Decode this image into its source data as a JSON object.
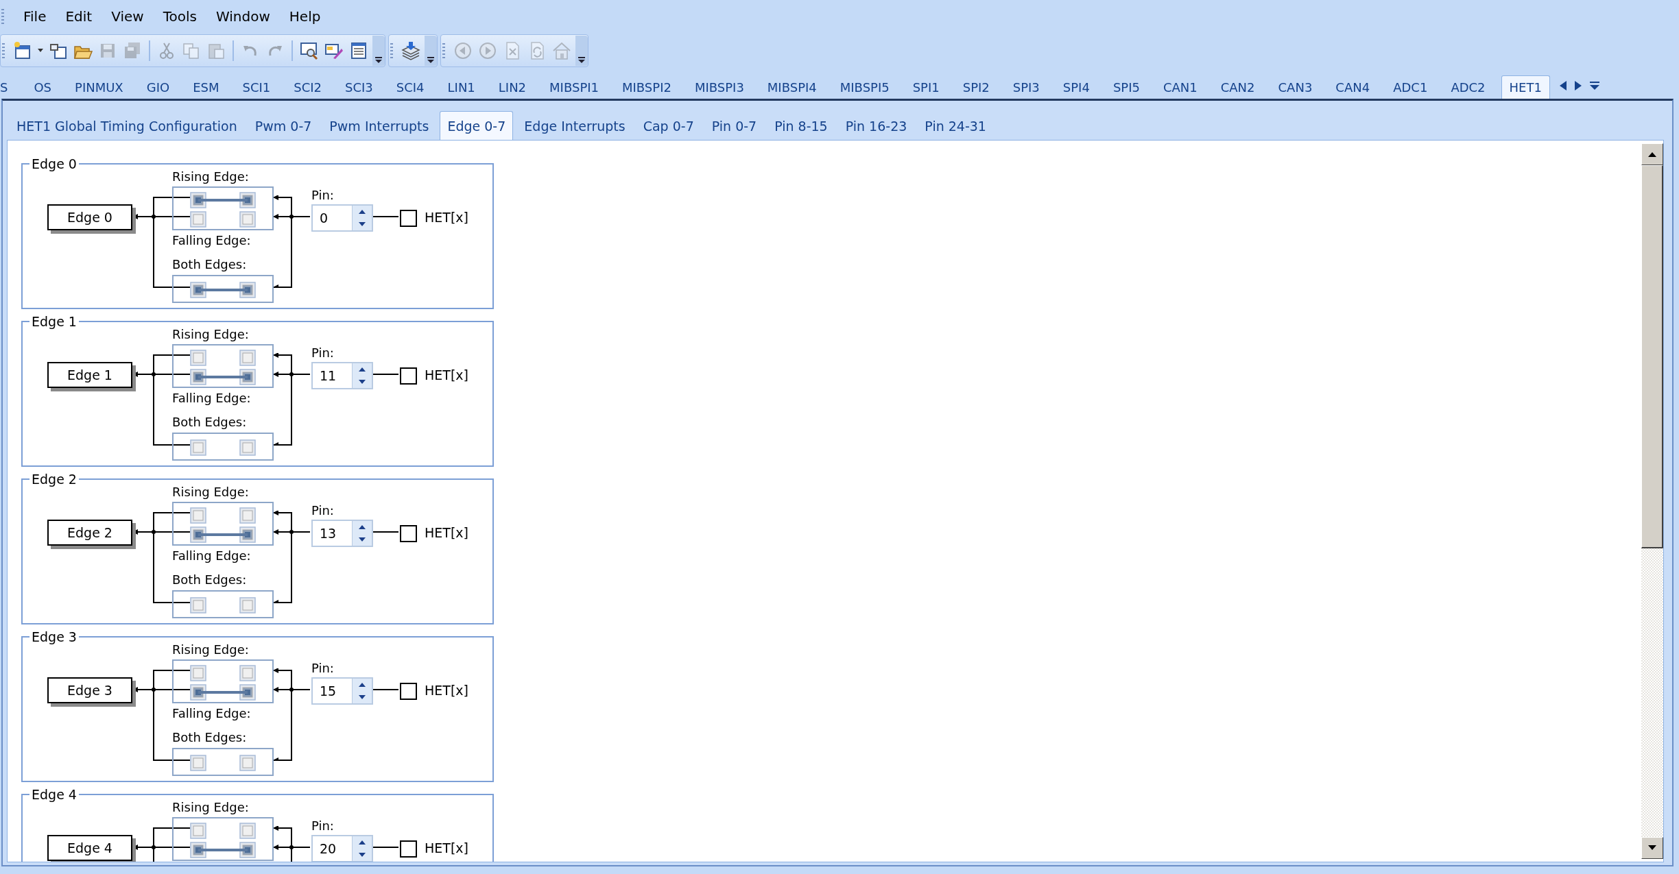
{
  "menu": [
    {
      "label": "File"
    },
    {
      "label": "Edit"
    },
    {
      "label": "View"
    },
    {
      "label": "Tools"
    },
    {
      "label": "Window"
    },
    {
      "label": "Help"
    }
  ],
  "toolbar": [
    {
      "items": [
        {
          "disabled": false
        },
        {
          "disabled": false
        },
        {
          "disabled": false
        },
        {
          "disabled": false
        },
        {
          "disabled": true
        },
        {
          "disabled": true
        },
        {
          "disabled": true
        },
        {
          "disabled": true
        },
        {
          "disabled": true
        },
        {
          "disabled": true
        },
        {
          "disabled": true
        },
        {
          "disabled": false
        },
        {
          "disabled": false
        },
        {
          "disabled": false
        }
      ]
    },
    {
      "items": [
        {
          "disabled": false
        }
      ]
    },
    {
      "items": [
        {
          "disabled": true
        },
        {
          "disabled": true
        },
        {
          "disabled": true
        },
        {
          "disabled": true
        },
        {
          "disabled": true
        }
      ]
    }
  ],
  "module_tabs": [
    {
      "label": "S",
      "selected": false
    },
    {
      "label": "OS",
      "selected": false
    },
    {
      "label": "PINMUX",
      "selected": false
    },
    {
      "label": "GIO",
      "selected": false
    },
    {
      "label": "ESM",
      "selected": false
    },
    {
      "label": "SCI1",
      "selected": false
    },
    {
      "label": "SCI2",
      "selected": false
    },
    {
      "label": "SCI3",
      "selected": false
    },
    {
      "label": "SCI4",
      "selected": false
    },
    {
      "label": "LIN1",
      "selected": false
    },
    {
      "label": "LIN2",
      "selected": false
    },
    {
      "label": "MIBSPI1",
      "selected": false
    },
    {
      "label": "MIBSPI2",
      "selected": false
    },
    {
      "label": "MIBSPI3",
      "selected": false
    },
    {
      "label": "MIBSPI4",
      "selected": false
    },
    {
      "label": "MIBSPI5",
      "selected": false
    },
    {
      "label": "SPI1",
      "selected": false
    },
    {
      "label": "SPI2",
      "selected": false
    },
    {
      "label": "SPI3",
      "selected": false
    },
    {
      "label": "SPI4",
      "selected": false
    },
    {
      "label": "SPI5",
      "selected": false
    },
    {
      "label": "CAN1",
      "selected": false
    },
    {
      "label": "CAN2",
      "selected": false
    },
    {
      "label": "CAN3",
      "selected": false
    },
    {
      "label": "CAN4",
      "selected": false
    },
    {
      "label": "ADC1",
      "selected": false
    },
    {
      "label": "ADC2",
      "selected": false
    },
    {
      "label": "HET1",
      "selected": true
    }
  ],
  "sub_tabs": [
    {
      "label": "HET1 Global Timing Configuration",
      "selected": false
    },
    {
      "label": "Pwm 0-7",
      "selected": false
    },
    {
      "label": "Pwm Interrupts",
      "selected": false
    },
    {
      "label": "Edge 0-7",
      "selected": true
    },
    {
      "label": "Edge Interrupts",
      "selected": false
    },
    {
      "label": "Cap 0-7",
      "selected": false
    },
    {
      "label": "Pin 0-7",
      "selected": false
    },
    {
      "label": "Pin 8-15",
      "selected": false
    },
    {
      "label": "Pin 16-23",
      "selected": false
    },
    {
      "label": "Pin 24-31",
      "selected": false
    }
  ],
  "edges": [
    {
      "legend": "Edge 0",
      "block": "Edge 0",
      "rising_label": "Rising Edge:",
      "falling_label": "Falling Edge:",
      "both_label": "Both Edges:",
      "rising": true,
      "falling": false,
      "both": true,
      "pin_label": "Pin:",
      "pin": "0",
      "output_checked": false,
      "output_label": "HET[x]"
    },
    {
      "legend": "Edge 1",
      "block": "Edge 1",
      "rising_label": "Rising Edge:",
      "falling_label": "Falling Edge:",
      "both_label": "Both Edges:",
      "rising": false,
      "falling": true,
      "both": false,
      "pin_label": "Pin:",
      "pin": "11",
      "output_checked": false,
      "output_label": "HET[x]"
    },
    {
      "legend": "Edge 2",
      "block": "Edge 2",
      "rising_label": "Rising Edge:",
      "falling_label": "Falling Edge:",
      "both_label": "Both Edges:",
      "rising": false,
      "falling": true,
      "both": false,
      "pin_label": "Pin:",
      "pin": "13",
      "output_checked": false,
      "output_label": "HET[x]"
    },
    {
      "legend": "Edge 3",
      "block": "Edge 3",
      "rising_label": "Rising Edge:",
      "falling_label": "Falling Edge:",
      "both_label": "Both Edges:",
      "rising": false,
      "falling": true,
      "both": false,
      "pin_label": "Pin:",
      "pin": "15",
      "output_checked": false,
      "output_label": "HET[x]"
    },
    {
      "legend": "Edge 4",
      "block": "Edge 4",
      "rising_label": "Rising Edge:",
      "rising": false,
      "falling": true,
      "pin_label": "Pin:",
      "pin": "20",
      "output_checked": false,
      "output_label": "HET[x]"
    }
  ]
}
